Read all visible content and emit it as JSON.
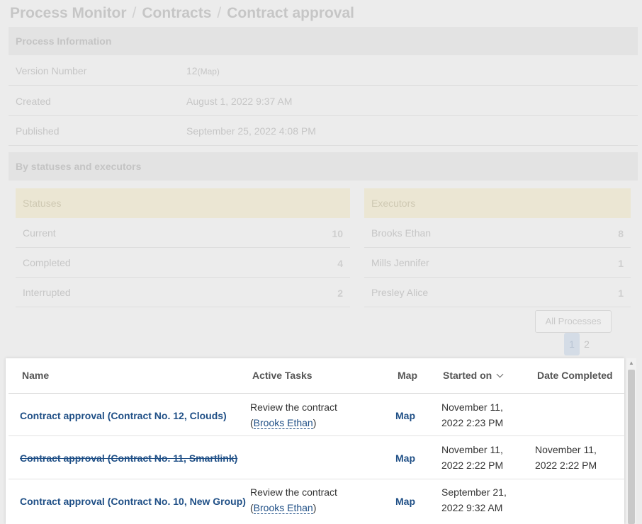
{
  "breadcrumb": {
    "items": [
      "Process Monitor",
      "Contracts",
      "Contract approval"
    ],
    "separator": "/"
  },
  "process_info": {
    "title": "Process Information",
    "rows": [
      {
        "label": "Version Number",
        "value": "12",
        "suffix": "(Map)"
      },
      {
        "label": "Created",
        "value": "August 1, 2022 9:37 AM"
      },
      {
        "label": "Published",
        "value": "September 25, 2022 4:08 PM"
      }
    ]
  },
  "by_statuses": {
    "title": "By statuses and executors",
    "statuses": {
      "title": "Statuses",
      "rows": [
        {
          "label": "Current",
          "count": "10"
        },
        {
          "label": "Completed",
          "count": "4"
        },
        {
          "label": "Interrupted",
          "count": "2"
        }
      ]
    },
    "executors": {
      "title": "Executors",
      "rows": [
        {
          "label": "Brooks Ethan",
          "count": "8"
        },
        {
          "label": "Mills Jennifer",
          "count": "1"
        },
        {
          "label": "Presley Alice",
          "count": "1"
        }
      ]
    },
    "all_processes_label": "All Processes",
    "pages": [
      "1",
      "2"
    ]
  },
  "table": {
    "columns": {
      "name": "Name",
      "active_tasks": "Active Tasks",
      "map": "Map",
      "started_on": "Started on",
      "date_completed": "Date Completed"
    },
    "rows": [
      {
        "name": "Contract approval (Contract No. 12, Clouds)",
        "task": "Review the contract",
        "executor": "Brooks Ethan",
        "map": "Map",
        "started_1": "November 11,",
        "started_2": "2022 2:23 PM",
        "completed_1": "",
        "completed_2": ""
      },
      {
        "name": "Contract approval (Contract No. 11, Smartlink)",
        "task": "",
        "executor": "",
        "map": "Map",
        "started_1": "November 11,",
        "started_2": "2022 2:22 PM",
        "completed_1": "November 11,",
        "completed_2": "2022 2:22 PM"
      },
      {
        "name": "Contract approval (Contract No. 10, New Group)",
        "task": "Review the contract",
        "executor": "Brooks Ethan",
        "map": "Map",
        "started_1": "September 21,",
        "started_2": "2022 9:32 AM",
        "completed_1": "",
        "completed_2": ""
      }
    ]
  },
  "colors": {
    "link": "#1f4f86",
    "status_header_bg": "#ebe6d3"
  }
}
